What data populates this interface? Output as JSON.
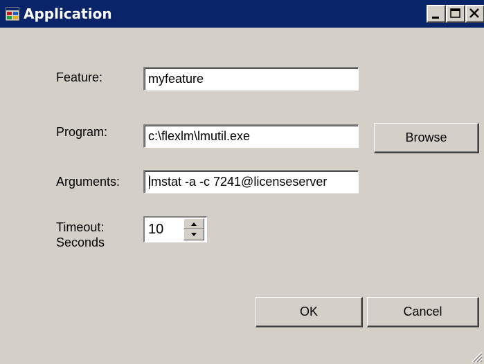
{
  "window": {
    "title": "Application"
  },
  "titlebar": {
    "minimize_icon": "minimize-icon",
    "maximize_icon": "maximize-icon",
    "close_icon": "close-icon"
  },
  "form": {
    "feature": {
      "label": "Feature:",
      "value": "myfeature"
    },
    "program": {
      "label": "Program:",
      "value": "c:\\flexlm\\lmutil.exe",
      "browse_label": "Browse"
    },
    "arguments": {
      "label": "Arguments:",
      "value": "lmstat -a -c 7241@licenseserver"
    },
    "timeout": {
      "label": "Timeout:\nSeconds",
      "value": "10"
    }
  },
  "buttons": {
    "ok": "OK",
    "cancel": "Cancel"
  },
  "colors": {
    "titlebar": "#0a246a",
    "window_bg": "#d4d0c8"
  }
}
